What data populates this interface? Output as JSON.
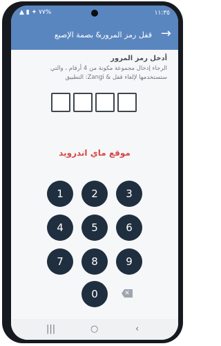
{
  "status_bar": {
    "time": "١١:٣٥",
    "icons": "▲ ▮ ✦ ٧٧%"
  },
  "toolbar": {
    "title": "قفل رمز المرور& بصمة الإصبع",
    "back_icon": "arrow-right-icon"
  },
  "content": {
    "heading": "أدخل رمز المرور",
    "instructions": "الرجاء إدخال مجموعة مكونة من 4 أرقام ، والتي ستستخدمها لإلغاء قفل & Zangi: التطبيق"
  },
  "pin": {
    "boxes": [
      "",
      "",
      "",
      ""
    ]
  },
  "watermark": "موقع ماي اندرويد",
  "keypad": {
    "keys": [
      "1",
      "2",
      "3",
      "4",
      "5",
      "6",
      "7",
      "8",
      "9",
      "0"
    ],
    "backspace_icon": "backspace-icon",
    "backspace_glyph": "✕"
  },
  "navbar": {
    "recents": "|||",
    "home": "○",
    "back": "‹"
  },
  "colors": {
    "accent": "#5a86bf",
    "key_fill": "#1f2f3f",
    "watermark": "#d84747"
  }
}
